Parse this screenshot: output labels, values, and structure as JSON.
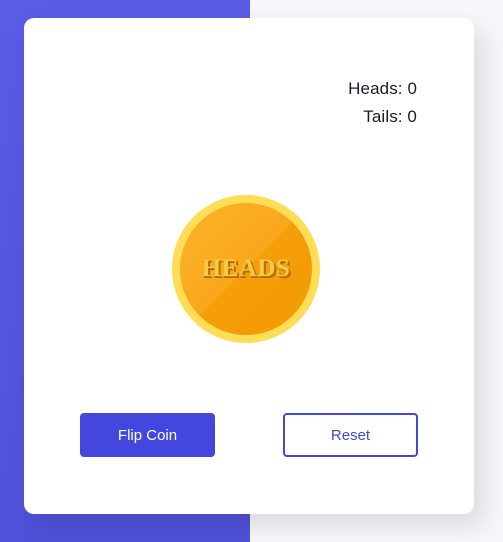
{
  "score": {
    "heads_label": "Heads: 0",
    "tails_label": "Tails: 0",
    "heads": 0,
    "tails": 0
  },
  "coin": {
    "face": "HEADS"
  },
  "buttons": {
    "flip_label": "Flip Coin",
    "reset_label": "Reset"
  },
  "colors": {
    "background_left": "#5b5ce6",
    "background_right": "#f7f8fb",
    "card": "#ffffff",
    "accent": "#4347dd",
    "coin_rim": "#ffdd57",
    "coin_face": "#f9a71c",
    "coin_text": "#f7c948"
  }
}
